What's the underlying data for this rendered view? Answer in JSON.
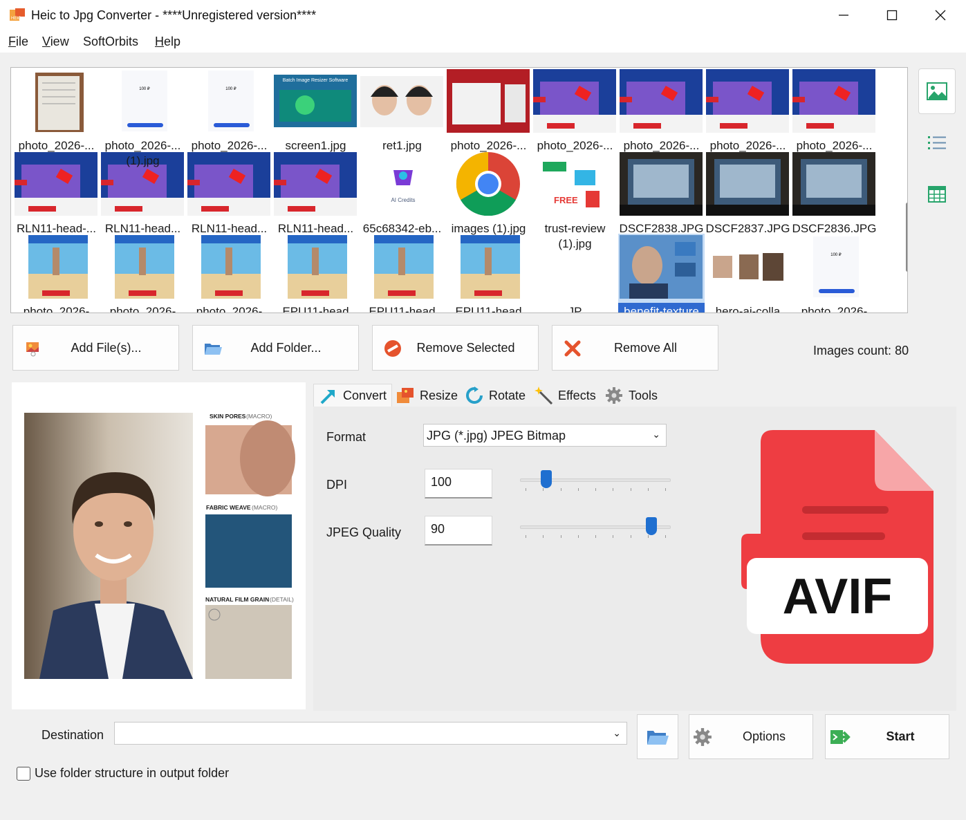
{
  "window": {
    "title": "Heic to Jpg Converter - ****Unregistered version****"
  },
  "menu": [
    {
      "label": "File",
      "u": "F",
      "rest": "ile"
    },
    {
      "label": "View",
      "u": "V",
      "rest": "iew"
    },
    {
      "label": "SoftOrbits",
      "u": "",
      "rest": "SoftOrbits"
    },
    {
      "label": "Help",
      "u": "H",
      "rest": "elp"
    }
  ],
  "thumbnails": [
    {
      "label": "photo_2026-...",
      "label2": "",
      "kind": "doc"
    },
    {
      "label": "photo_2026-...",
      "label2": "(1).jpg",
      "kind": "phone"
    },
    {
      "label": "photo_2026-...",
      "label2": "",
      "kind": "phone"
    },
    {
      "label": "screen1.jpg",
      "label2": "",
      "kind": "banner"
    },
    {
      "label": "ret1.jpg",
      "label2": "",
      "kind": "faces"
    },
    {
      "label": "photo_2026-...",
      "label2": "",
      "kind": "red"
    },
    {
      "label": "photo_2026-...",
      "label2": "",
      "kind": "promo"
    },
    {
      "label": "photo_2026-...",
      "label2": "",
      "kind": "promo"
    },
    {
      "label": "photo_2026-...",
      "label2": "",
      "kind": "promo"
    },
    {
      "label": "photo_2026-...",
      "label2": "",
      "kind": "promo"
    },
    {
      "label": "RLN11-head-...",
      "label2": "",
      "kind": "promo"
    },
    {
      "label": "RLN11-head...",
      "label2": "",
      "kind": "promo"
    },
    {
      "label": "RLN11-head...",
      "label2": "",
      "kind": "promo"
    },
    {
      "label": "RLN11-head...",
      "label2": "",
      "kind": "promo"
    },
    {
      "label": "65c68342-eb...",
      "label2": "",
      "kind": "ai"
    },
    {
      "label": "images (1).jpg",
      "label2": "",
      "kind": "chrome"
    },
    {
      "label": "trust-review",
      "label2": "(1).jpg",
      "kind": "free"
    },
    {
      "label": "DSCF2838.JPG",
      "label2": "",
      "kind": "screen"
    },
    {
      "label": "DSCF2837.JPG",
      "label2": "",
      "kind": "screen"
    },
    {
      "label": "DSCF2836.JPG",
      "label2": "",
      "kind": "screen"
    },
    {
      "label": "photo_2026-",
      "label2": "",
      "kind": "beach"
    },
    {
      "label": "photo_2026-",
      "label2": "",
      "kind": "beach"
    },
    {
      "label": "photo_2026-",
      "label2": "",
      "kind": "beach"
    },
    {
      "label": "EPU11-head",
      "label2": "",
      "kind": "beach"
    },
    {
      "label": "EPU11-head",
      "label2": "",
      "kind": "beach"
    },
    {
      "label": "EPU11-head",
      "label2": "",
      "kind": "beach"
    },
    {
      "label": "JP",
      "label2": "",
      "kind": "blank"
    },
    {
      "label": "benefit-texture",
      "label2": "",
      "kind": "portrait"
    },
    {
      "label": "hero-ai-colla",
      "label2": "",
      "kind": "collage"
    },
    {
      "label": "photo_2026-",
      "label2": "",
      "kind": "phone"
    }
  ],
  "actions": {
    "add_files": "Add File(s)...",
    "add_folder": "Add Folder...",
    "remove_selected": "Remove Selected",
    "remove_all": "Remove All",
    "count": "Images count: 80"
  },
  "preview": {
    "labels": [
      "SKIN PORES",
      "(MACRO)",
      "FABRIC WEAVE",
      "(MACRO)",
      "NATURAL FILM GRAIN",
      "(DETAIL)"
    ]
  },
  "tabs": [
    "Convert",
    "Resize",
    "Rotate",
    "Effects",
    "Tools"
  ],
  "convert": {
    "format_label": "Format",
    "format_value": "JPG (*.jpg) JPEG Bitmap",
    "dpi_label": "DPI",
    "dpi_value": "100",
    "dpi_slider": 0.15,
    "quality_label": "JPEG Quality",
    "quality_value": "90",
    "quality_slider": 0.9,
    "badge_text": "AVIF"
  },
  "bottom": {
    "destination_label": "Destination",
    "destination_value": "",
    "options_label": "Options",
    "start_label": "Start",
    "folder_structure_label": "Use folder structure in output folder"
  },
  "colors": {
    "accent": "#1f6fd0",
    "avif_red": "#ee3d42",
    "avif_fold": "#f7a6a8"
  }
}
